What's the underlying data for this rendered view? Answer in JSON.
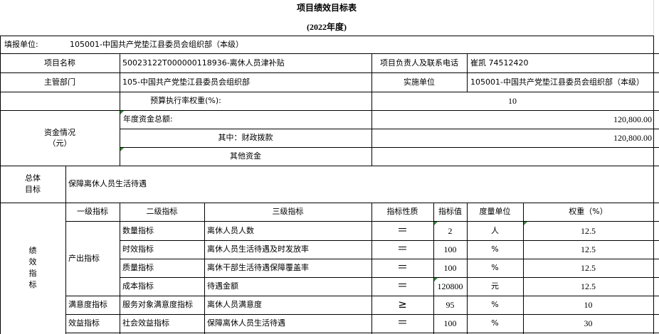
{
  "title": "项目绩效目标表",
  "year": "(2022年度)",
  "filling_unit": {
    "label": "填报单位:",
    "value": "105001-中国共产党垫江县委员会组织部（本级）"
  },
  "project_name": {
    "label": "项目名称",
    "value": "50023122T000000118936-离休人员津补贴"
  },
  "project_leader": {
    "label": "项目负责人及联系电话",
    "value": "崔凯 74512420"
  },
  "competent_dept": {
    "label": "主管部门",
    "value": "105-中国共产党垫江县委员会组织部"
  },
  "implementing_unit": {
    "label": "实施单位",
    "value": "105001-中国共产党垫江县委员会组织部（本级）"
  },
  "budget_weight": {
    "label": "预算执行率权重(%):",
    "value": "10"
  },
  "funding": {
    "label_line1": "资金情况",
    "label_line2": "（元）",
    "annual_total_label": "年度资金总额:",
    "annual_total_value": "120,800.00",
    "fiscal_label": "其中：财政拨款",
    "fiscal_value": "120,800.00",
    "other_label": "其他资金",
    "other_value": ""
  },
  "overall_goal": {
    "label_line1": "总体",
    "label_line2": "目标",
    "value": "保障离休人员生活待遇"
  },
  "performance": {
    "side_label": [
      "绩",
      "效",
      "指",
      "标"
    ],
    "headers": [
      "一级指标",
      "二级指标",
      "三级指标",
      "指标性质",
      "指标值",
      "度量单位",
      "权重（%）"
    ],
    "groups": [
      {
        "level1": "产出指标"
      },
      {
        "level1": "满意度指标"
      },
      {
        "level1": "效益指标"
      }
    ],
    "rows": [
      {
        "level2": "数量指标",
        "level3": "离休人员人数",
        "nature": "＝",
        "value": "2",
        "unit": "人",
        "weight": "12.5"
      },
      {
        "level2": "时效指标",
        "level3": "离休人员生活待遇及时发放率",
        "nature": "＝",
        "value": "100",
        "unit": "%",
        "weight": "12.5"
      },
      {
        "level2": "质量指标",
        "level3": "离休干部生活待遇保障覆盖率",
        "nature": "＝",
        "value": "100",
        "unit": "%",
        "weight": "12.5"
      },
      {
        "level2": "成本指标",
        "level3": "待遇金额",
        "nature": "＝",
        "value": "120800",
        "unit": "元",
        "weight": "12.5"
      },
      {
        "level2": "服务对象满意度指标",
        "level3": "离休人员满意度",
        "nature": "≥",
        "value": "95",
        "unit": "%",
        "weight": "10"
      },
      {
        "level2": "社会效益指标",
        "level3": "保障离休人员生活待遇",
        "nature": "＝",
        "value": "100",
        "unit": "%",
        "weight": "30"
      }
    ]
  },
  "colors": {
    "grid": "#000000",
    "marker": "#2e8b2e",
    "sheet_lines": "#d9d9d9"
  }
}
